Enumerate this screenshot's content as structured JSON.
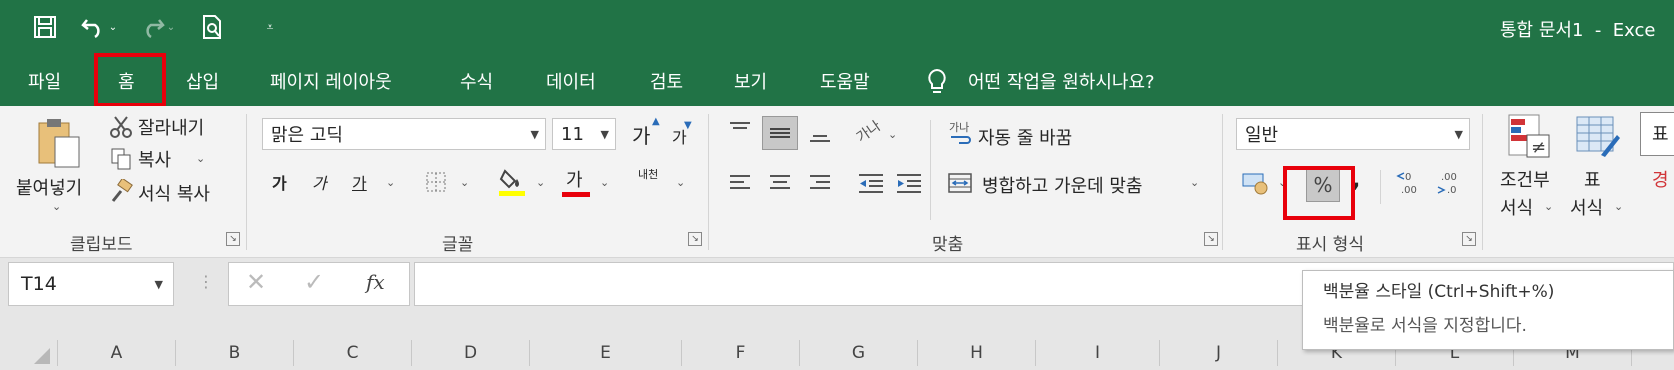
{
  "window": {
    "title": "통합 문서1  -  Exce"
  },
  "quick_access": {
    "icons": [
      "save-icon",
      "undo-icon",
      "redo-icon",
      "print-preview-icon",
      "customize-qat-icon"
    ]
  },
  "tabs": [
    {
      "label": "파일"
    },
    {
      "label": "홈",
      "active": true
    },
    {
      "label": "삽입"
    },
    {
      "label": "페이지 레이아웃"
    },
    {
      "label": "수식"
    },
    {
      "label": "데이터"
    },
    {
      "label": "검토"
    },
    {
      "label": "보기"
    },
    {
      "label": "도움말"
    }
  ],
  "tell_me": {
    "placeholder": "어떤 작업을 원하시나요?"
  },
  "clipboard": {
    "paste_label": "붙여넣기",
    "cut_label": "잘라내기",
    "copy_label": "복사",
    "format_painter_label": "서식 복사",
    "group_label": "클립보드"
  },
  "font": {
    "font_name": "맑은 고딕",
    "font_size": "11",
    "increase_label": "가",
    "decrease_label": "가",
    "bold": "가",
    "italic": "가",
    "underline": "가",
    "font_color_label": "가",
    "phonetic_label": "내천",
    "group_label": "글꼴",
    "highlight_color": "#ffff00",
    "font_color": "#e8000b"
  },
  "alignment": {
    "wrap_text_label": "자동 줄 바꿈",
    "merge_center_label": "병합하고 가운데 맞춤",
    "group_label": "맞춤"
  },
  "number": {
    "format_value": "일반",
    "percent_label": "%",
    "comma_label": ",",
    "increase_decimal_label": ".00",
    "decrease_decimal_label": ".00",
    "group_label": "표시 형식"
  },
  "styles": {
    "conditional_format_label": "조건부",
    "conditional_format_label2": "서식",
    "format_table_label": "표",
    "format_table_label2": "서식",
    "cell_styles_label": "표",
    "cell_styles_label2": "경"
  },
  "formula_bar": {
    "name_box": "T14",
    "fx_label": "fx"
  },
  "tooltip": {
    "title": "백분율 스타일 (Ctrl+Shift+%)",
    "description": "백분율로 서식을 지정합니다."
  },
  "columns": [
    "A",
    "B",
    "C",
    "D",
    "E",
    "F",
    "G",
    "H",
    "I",
    "J",
    "K",
    "L",
    "M"
  ],
  "colors": {
    "excel_green": "#217346",
    "highlight_red": "#e8000b"
  }
}
